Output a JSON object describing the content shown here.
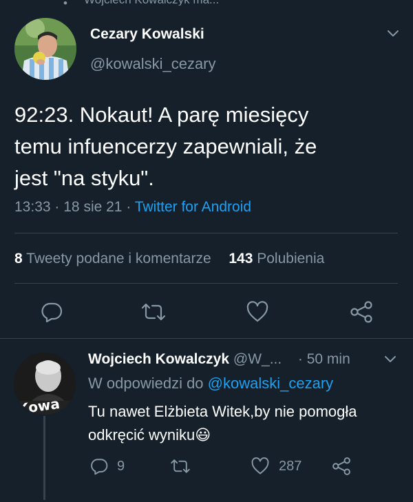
{
  "top_cut": {
    "text": "Wojciech Kowalczyk ma..."
  },
  "tweet": {
    "author_name": "Cezary Kowalski",
    "author_handle": "@kowalski_cezary",
    "text_lines": [
      "92:23. Nokaut! A parę miesięcy",
      "temu infuencerzy zapewniali, że",
      "jest \"na styku\"."
    ],
    "time": "13:33",
    "sep1": "·",
    "date": "18 sie 21",
    "sep2": "·",
    "source": "Twitter for Android",
    "retweets_count": "8",
    "retweets_label": "Tweety podane i komentarze",
    "likes_count": "143",
    "likes_label": "Polubienia"
  },
  "reply": {
    "author_name": "Wojciech Kowalczyk",
    "author_handle": "@W_...",
    "dot": "·",
    "time_ago": "50 min",
    "replying_prefix": "W odpowiedzi do",
    "replying_to": "@kowalski_cezary",
    "text_lines": [
      "Tu nawet Elżbieta Witek,by nie pomogła",
      "odkręcić wyniku"
    ],
    "emoji": "😃",
    "replies_count": "9",
    "likes_count": "287"
  },
  "colors": {
    "background": "#15202b",
    "text": "#ffffff",
    "muted": "#8899a6",
    "link": "#1da1f2",
    "divider": "#38444d"
  }
}
